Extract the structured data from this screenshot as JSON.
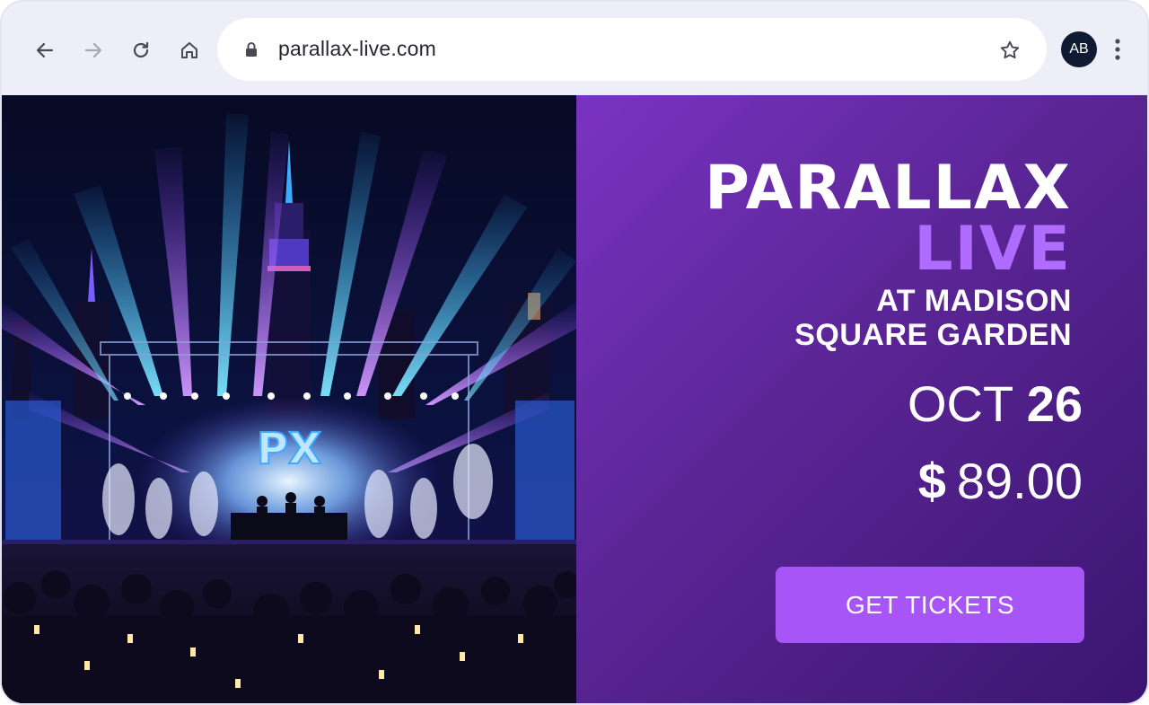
{
  "browser": {
    "url": "parallax-live.com",
    "profile_initials": "AB",
    "icons": {
      "back": "arrow-left-icon",
      "forward": "arrow-right-icon",
      "reload": "reload-icon",
      "home": "home-icon",
      "lock": "lock-icon",
      "bookmark": "star-icon",
      "menu": "more-vertical-icon"
    }
  },
  "event": {
    "title_line1": "PARALLAX",
    "title_line2": "LIVE",
    "venue_line1": "AT MADISON",
    "venue_line2": "SQUARE GARDEN",
    "date_month": "OCT",
    "date_day": "26",
    "price_currency": "$",
    "price_amount": "89.00",
    "cta_label": "GET TICKETS",
    "stage_logo": "PX"
  },
  "colors": {
    "accent": "#a855f7",
    "title_accent": "#b06bff",
    "panel_gradient_start": "#7a33c2",
    "panel_gradient_end": "#3a1570",
    "avatar_bg": "#0f1a33"
  }
}
